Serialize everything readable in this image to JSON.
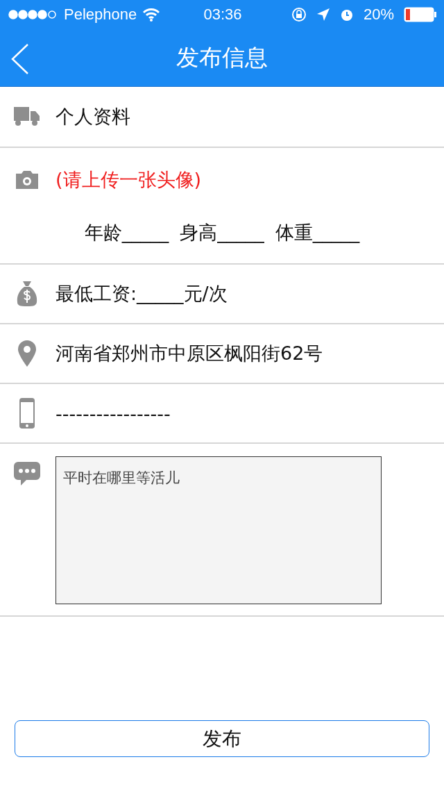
{
  "status_bar": {
    "carrier": "Pelephone",
    "time": "03:36",
    "battery": "20%"
  },
  "nav": {
    "title": "发布信息"
  },
  "rows": [
    {
      "kind": "header",
      "text": "个人资料"
    },
    {
      "kind": "photo",
      "hint": "(请上传一张头像)",
      "stats": [
        "年龄_____",
        "身高_____",
        "体重_____"
      ]
    },
    {
      "kind": "salary",
      "text": "最低工资:_____元/次"
    },
    {
      "kind": "address",
      "text": "河南省郑州市中原区枫阳街62号"
    },
    {
      "kind": "phone",
      "text": "-----------------"
    },
    {
      "kind": "note",
      "placeholder": "平时在哪里等活儿"
    }
  ],
  "submit": {
    "label": "发布"
  }
}
